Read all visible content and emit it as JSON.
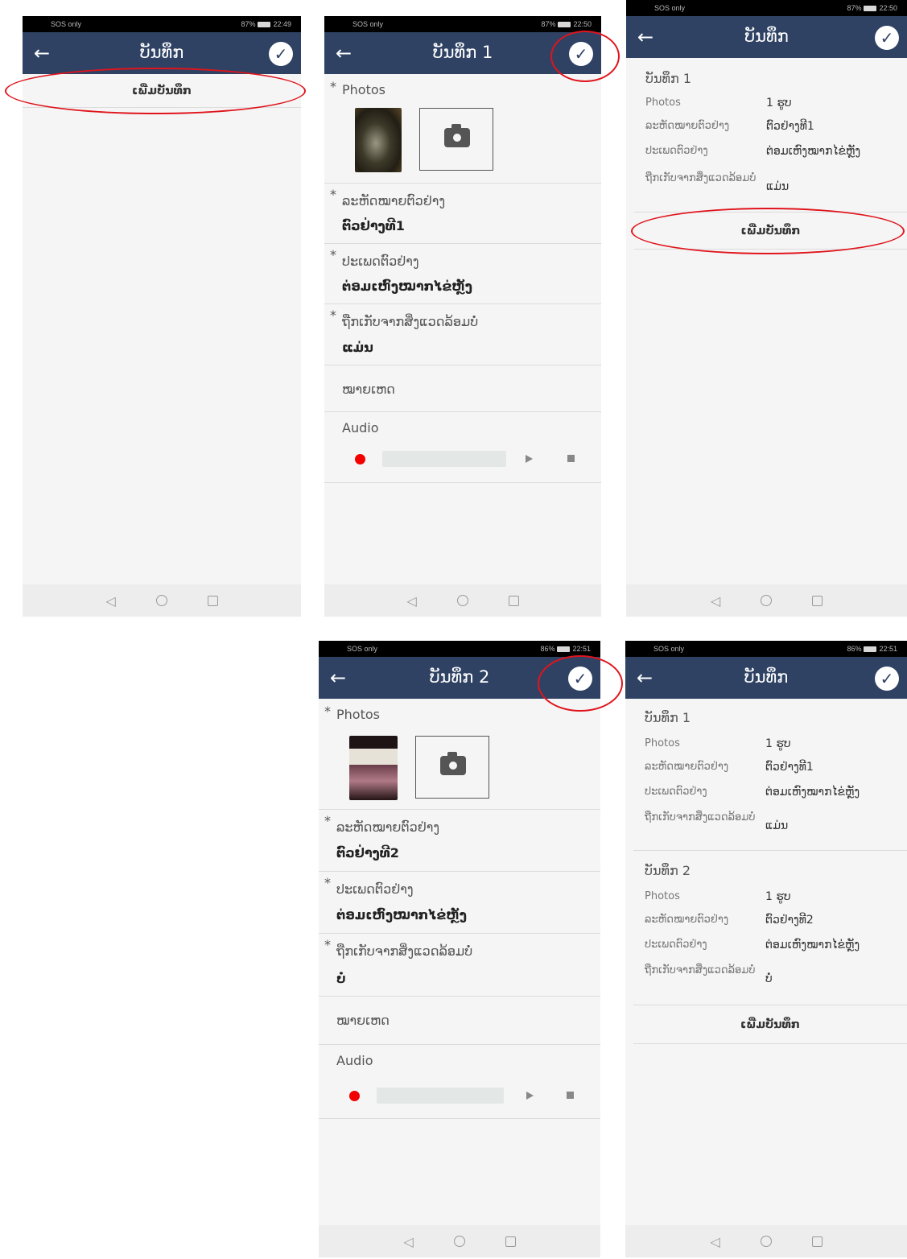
{
  "screens": {
    "s1": {
      "status": {
        "left": "SOS only",
        "battery": "87%",
        "time": "22:49"
      },
      "title": "ບັນທຶກ",
      "add_label": "ເພີ່ມບັນທຶກ"
    },
    "s2": {
      "status": {
        "left": "SOS only",
        "battery": "87%",
        "time": "22:50"
      },
      "title": "ບັນທຶກ 1",
      "photos_label": "Photos",
      "code_label": "ລະຫັດໝາຍຕົວຢ່າງ",
      "code_value": "ຕົວຢ່າງທີ1",
      "type_label": "ປະເພດຕົວຢ່າງ",
      "type_value": "ຕ່ອມເຫົງໝາກໄຂ່ຫຼັງ",
      "env_label": "ຖືກເກັບຈາກສິ່ງແວດລ້ອມບໍ່",
      "env_value": "ແມ່ນ",
      "note_label": "ໝາຍເຫດ",
      "audio_label": "Audio"
    },
    "s3": {
      "status": {
        "left": "SOS only",
        "battery": "87%",
        "time": "22:50"
      },
      "title": "ບັນທຶກ",
      "record_title": "ບັນທຶກ 1",
      "rows": [
        {
          "k": "Photos",
          "v": "1 ຮູບ"
        },
        {
          "k": "ລະຫັດໝາຍຕົວຢ່າງ",
          "v": "ຕົວຢ່າງທີ1"
        },
        {
          "k": "ປະເພດຕົວຢ່າງ",
          "v": "ຕ່ອມເຫົງໝາກໄຂ່ຫຼັງ"
        },
        {
          "k": "ຖືກເກັບຈາກສິ່ງແວດລ້ອມບໍ່",
          "v": "ແມ່ນ"
        }
      ],
      "add_label": "ເພີ່ມບັນທຶກ"
    },
    "s4": {
      "status": {
        "left": "SOS only",
        "battery": "86%",
        "time": "22:51"
      },
      "title": "ບັນທຶກ 2",
      "photos_label": "Photos",
      "code_label": "ລະຫັດໝາຍຕົວຢ່າງ",
      "code_value": "ຕົວຢ່າງທີ2",
      "type_label": "ປະເພດຕົວຢ່າງ",
      "type_value": "ຕ່ອມເຫົງໝາກໄຂ່ຫຼັງ",
      "env_label": "ຖືກເກັບຈາກສິ່ງແວດລ້ອມບໍ່",
      "env_value": "ບໍ່",
      "note_label": "ໝາຍເຫດ",
      "audio_label": "Audio"
    },
    "s5": {
      "status": {
        "left": "SOS only",
        "battery": "86%",
        "time": "22:51"
      },
      "title": "ບັນທຶກ",
      "record1_title": "ບັນທຶກ 1",
      "rows1": [
        {
          "k": "Photos",
          "v": "1 ຮູບ"
        },
        {
          "k": "ລະຫັດໝາຍຕົວຢ່າງ",
          "v": "ຕົວຢ່າງທີ1"
        },
        {
          "k": "ປະເພດຕົວຢ່າງ",
          "v": "ຕ່ອມເຫົງໝາກໄຂ່ຫຼັງ"
        },
        {
          "k": "ຖືກເກັບຈາກສິ່ງແວດລ້ອມບໍ່",
          "v": "ແມ່ນ"
        }
      ],
      "record2_title": "ບັນທຶກ 2",
      "rows2": [
        {
          "k": "Photos",
          "v": "1 ຮູບ"
        },
        {
          "k": "ລະຫັດໝາຍຕົວຢ່າງ",
          "v": "ຕົວຢ່າງທີ2"
        },
        {
          "k": "ປະເພດຕົວຢ່າງ",
          "v": "ຕ່ອມເຫົງໝາກໄຂ່ຫຼັງ"
        },
        {
          "k": "ຖືກເກັບຈາກສິ່ງແວດລ້ອມບໍ່",
          "v": "ບໍ່"
        }
      ],
      "add_label": "ເພີ່ມບັນທຶກ"
    }
  },
  "colors": {
    "appbar": "#2f4264",
    "annotation": "#e0141c",
    "record": "#f20000"
  },
  "icons": {
    "back": "arrow-left-icon",
    "save": "check-circle-icon",
    "camera": "camera-icon"
  }
}
